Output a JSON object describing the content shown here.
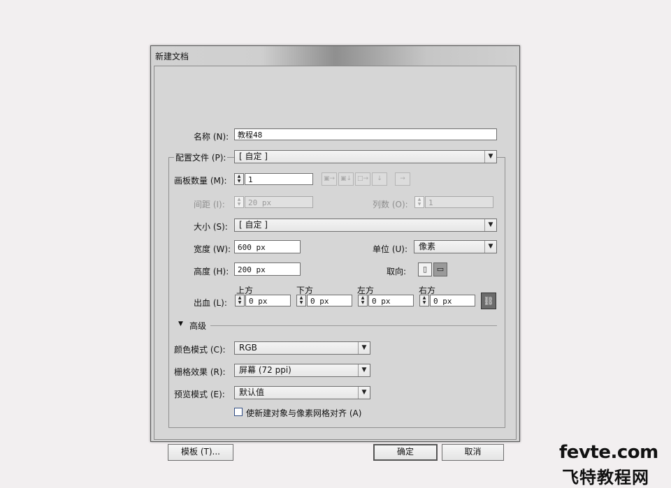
{
  "dialog": {
    "title": "新建文档",
    "name_label": "名称 (N):",
    "name_value": "教程48",
    "profile_label": "配置文件 (P):",
    "profile_value": "[ 自定 ]",
    "artboards_label": "画板数量 (M):",
    "artboards_value": "1",
    "spacing_label": "间距 (I):",
    "spacing_value": "20 px",
    "columns_label": "列数 (O):",
    "columns_value": "1",
    "size_label": "大小 (S):",
    "size_value": "[ 自定 ]",
    "width_label": "宽度 (W):",
    "width_value": "600 px",
    "units_label": "单位 (U):",
    "units_value": "像素",
    "height_label": "高度 (H):",
    "height_value": "200 px",
    "orientation_label": "取向:",
    "bleed_label": "出血 (L):",
    "bleed": {
      "top_label": "上方",
      "top_value": "0 px",
      "bottom_label": "下方",
      "bottom_value": "0 px",
      "left_label": "左方",
      "left_value": "0 px",
      "right_label": "右方",
      "right_value": "0 px"
    },
    "advanced_label": "高级",
    "color_mode_label": "颜色模式 (C):",
    "color_mode_value": "RGB",
    "raster_label": "栅格效果 (R):",
    "raster_value": "屏幕 (72 ppi)",
    "preview_label": "预览模式 (E):",
    "preview_value": "默认值",
    "align_pixel_label": "使新建对象与像素网格对齐 (A)",
    "templates_button": "模板 (T)...",
    "ok_button": "确定",
    "cancel_button": "取消"
  },
  "watermark": {
    "site": "fevte.com",
    "site_cn": "飞特教程网"
  }
}
